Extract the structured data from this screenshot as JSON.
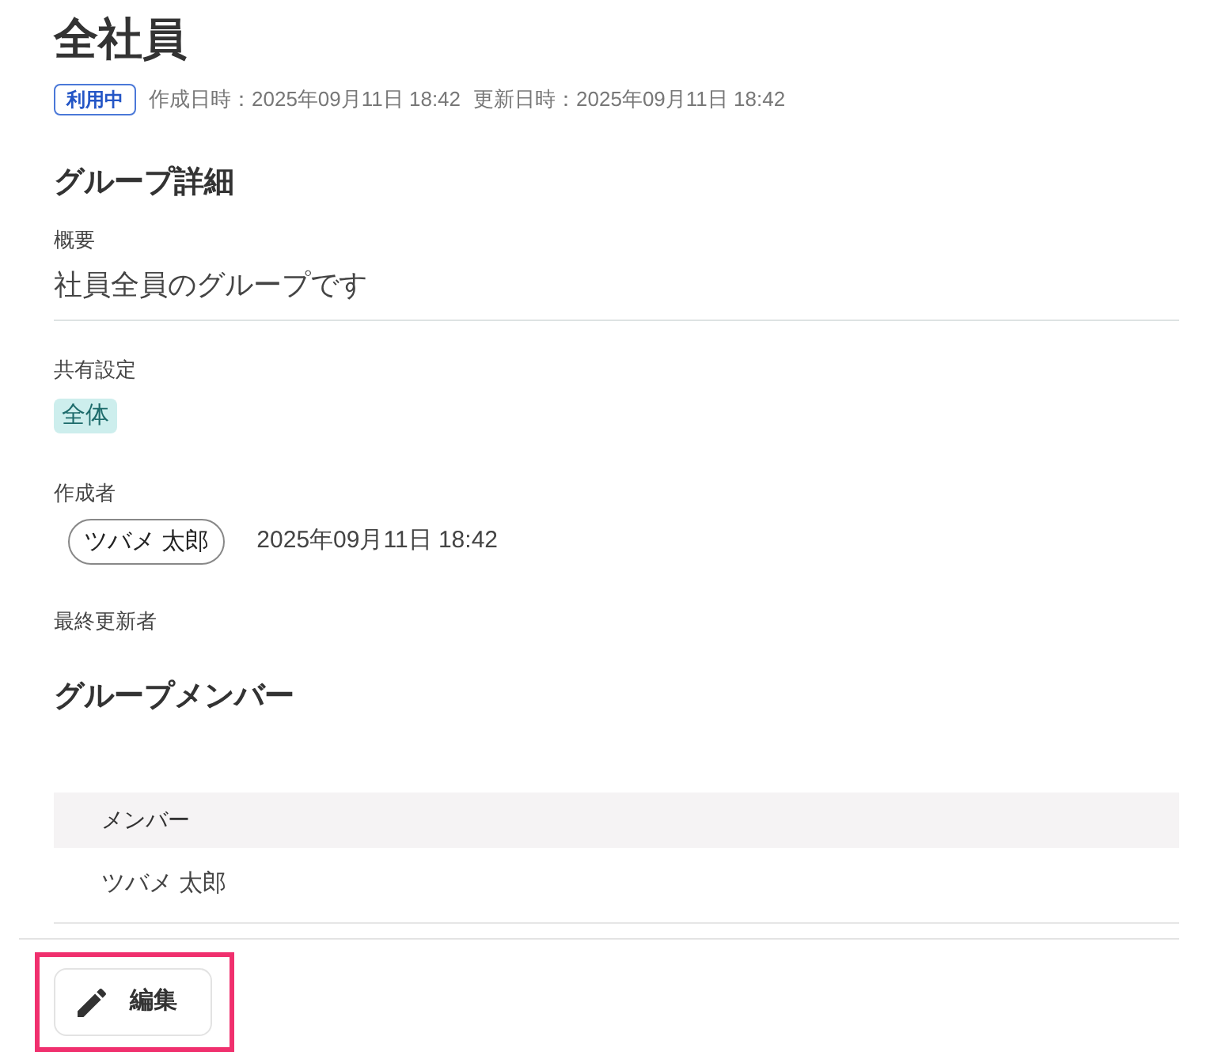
{
  "title": "全社員",
  "status_badge": "利用中",
  "created": "作成日時：2025年09月11日 18:42",
  "updated": "更新日時：2025年09月11日 18:42",
  "details": {
    "heading": "グループ詳細",
    "fields": [
      {
        "kind": "text",
        "label": "概要",
        "value": "社員全員のグループです"
      },
      {
        "kind": "tag",
        "label": "共有設定",
        "value": "全体"
      },
      {
        "kind": "user",
        "label": "作成者",
        "user": "ツバメ 太郎",
        "date": "2025年09月11日 18:42"
      },
      {
        "kind": "user",
        "label": "最終更新者"
      }
    ]
  },
  "members": {
    "heading": "グループメンバー",
    "columns": [
      "メンバー"
    ],
    "rows": [
      [
        "ツバメ 太郎"
      ]
    ]
  },
  "edit_button": {
    "label": "編集",
    "highlighted": true
  }
}
